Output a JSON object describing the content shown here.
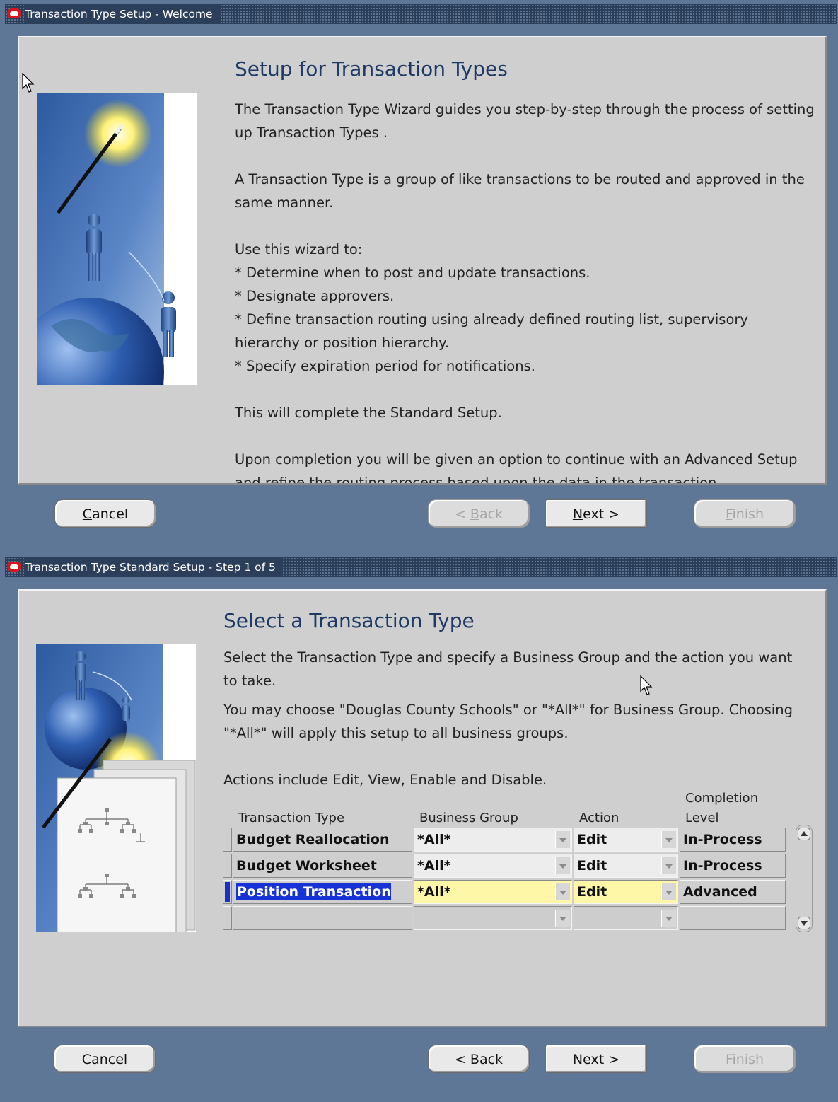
{
  "window1": {
    "title": "Transaction Type Setup - Welcome",
    "heading": "Setup for Transaction Types",
    "paragraphs": {
      "p1": "The Transaction Type Wizard guides you step-by-step through the process of setting up Transaction Types .",
      "p2": "A Transaction Type is a group of like transactions to be routed and approved in the same manner.",
      "p3_intro": "Use this wizard to:",
      "b1": "*  Determine when to post and update transactions.",
      "b2": "*  Designate approvers.",
      "b3": "*  Define transaction routing using already defined routing list, supervisory hierarchy or position hierarchy.",
      "b4": "*  Specify expiration period for notifications.",
      "p4": "This will complete the Standard Setup.",
      "p5": "Upon completion you will be given an option to continue with an Advanced Setup and refine the routing process based upon the data in the transaction."
    },
    "buttons": {
      "cancel_mnemonic": "C",
      "cancel_rest": "ancel",
      "back_prefix": "< ",
      "back_mnemonic": "B",
      "back_rest": "ack",
      "next_mnemonic": "N",
      "next_rest": "ext >",
      "finish_mnemonic": "F",
      "finish_rest": "inish"
    }
  },
  "window2": {
    "title": "Transaction Type Standard Setup - Step 1 of 5",
    "heading": "Select a Transaction Type",
    "paragraphs": {
      "p1": "Select the Transaction Type and specify a Business Group and the action you want to take.",
      "p2": "You may choose \"Douglas County Schools\" or \"*All*\" for Business Group. Choosing \"*All*\" will apply this setup to all business groups.",
      "p3": "Actions include Edit, View, Enable and Disable."
    },
    "table": {
      "headers": {
        "transaction_type": "Transaction Type",
        "business_group": "Business Group",
        "action": "Action",
        "completion_level_1": "Completion",
        "completion_level_2": "Level"
      },
      "rows": [
        {
          "transaction_type": "Budget Reallocation",
          "business_group": "*All*",
          "action": "Edit",
          "completion_level": "In-Process"
        },
        {
          "transaction_type": "Budget Worksheet",
          "business_group": "*All*",
          "action": "Edit",
          "completion_level": "In-Process"
        },
        {
          "transaction_type": "Position Transaction",
          "business_group": "*All*",
          "action": "Edit",
          "completion_level": "Advanced"
        }
      ]
    },
    "buttons": {
      "cancel_mnemonic": "C",
      "cancel_rest": "ancel",
      "back_prefix": "< ",
      "back_mnemonic": "B",
      "back_rest": "ack",
      "next_mnemonic": "N",
      "next_rest": "ext >",
      "finish_mnemonic": "F",
      "finish_rest": "inish"
    }
  },
  "colors": {
    "background": "#5f7796",
    "titlebar": "#2b3f5a",
    "panel": "#cfcfcf",
    "heading": "#1e3a64",
    "selection": "#1733d8",
    "current_field": "#fff7a8"
  },
  "icons": [
    "oracle-logo-icon",
    "wizard-illustration",
    "org-chart-illustration",
    "mouse-pointer-icon",
    "scroll-up-icon",
    "scroll-down-icon",
    "dropdown-arrow-icon"
  ]
}
